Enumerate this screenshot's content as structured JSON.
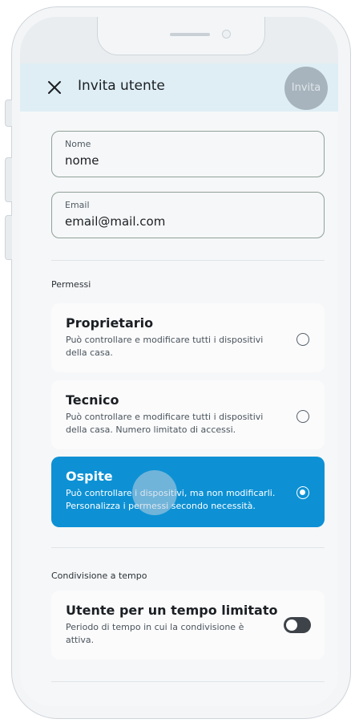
{
  "header": {
    "title": "Invita utente",
    "action_label": "Invita"
  },
  "form": {
    "name": {
      "label": "Nome",
      "value": "nome"
    },
    "email": {
      "label": "Email",
      "value": "email@mail.com"
    }
  },
  "permissions": {
    "section_label": "Permessi",
    "options": [
      {
        "title": "Proprietario",
        "description": "Può controllare e modificare tutti i dispositivi della casa.",
        "selected": false
      },
      {
        "title": "Tecnico",
        "description": "Può controllare e modificare tutti i dispositivi della casa. Numero limitato di accessi.",
        "selected": false
      },
      {
        "title": "Ospite",
        "description": "Può controllare i dispositivi, ma non modificarli. Personalizza i permessi secondo necessità.",
        "selected": true
      }
    ]
  },
  "time_sharing": {
    "section_label": "Condivisione a tempo",
    "title": "Utente per un tempo limitato",
    "description": "Periodo di tempo in cui la condivisione è attiva.",
    "enabled": false
  },
  "colors": {
    "accent": "#0d91d4",
    "header_bg": "#dfeef5"
  }
}
